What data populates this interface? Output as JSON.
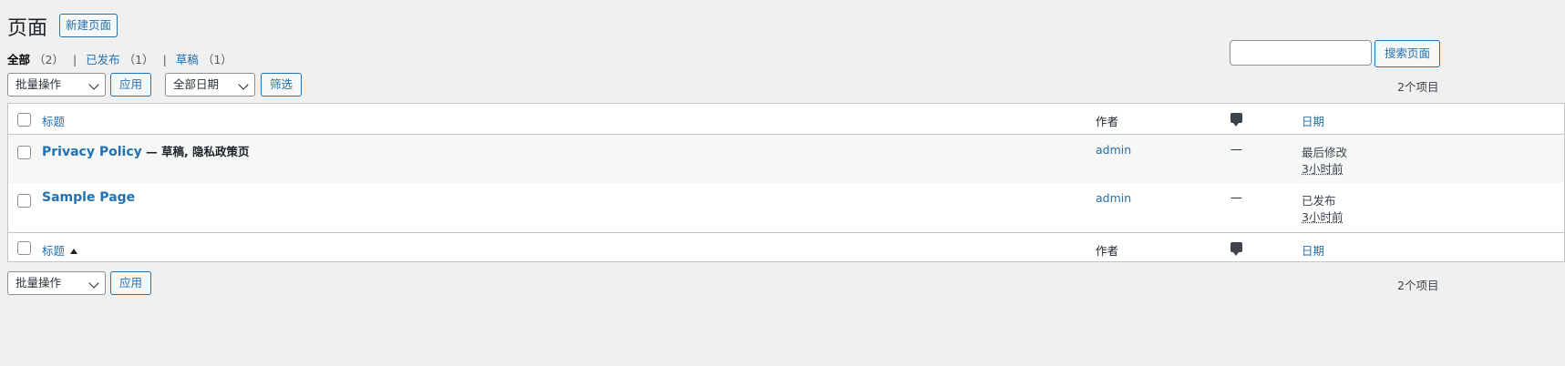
{
  "header": {
    "title": "页面",
    "add_new_label": "新建页面"
  },
  "views": [
    {
      "label": "全部",
      "count": "（2）",
      "current": true
    },
    {
      "label": "已发布",
      "count": "（1）",
      "current": false
    },
    {
      "label": "草稿",
      "count": "（1）",
      "current": false
    }
  ],
  "search": {
    "value": "",
    "button_label": "搜索页面"
  },
  "toolbar_top": {
    "bulk_action": "批量操作",
    "apply_label": "应用",
    "date_filter": "全部日期",
    "filter_label": "筛选",
    "items_count": "2个项目"
  },
  "table": {
    "columns": {
      "title": "标题",
      "author": "作者",
      "date": "日期"
    },
    "rows": [
      {
        "title": "Privacy Policy",
        "state": " — 草稿, 隐私政策页",
        "author": "admin",
        "comments": "—",
        "date_label": "最后修改",
        "date_value": "3小时前"
      },
      {
        "title": "Sample Page",
        "state": "",
        "author": "admin",
        "comments": "—",
        "date_label": "已发布",
        "date_value": "3小时前"
      }
    ]
  },
  "toolbar_bottom": {
    "bulk_action": "批量操作",
    "apply_label": "应用",
    "items_count": "2个项目"
  },
  "colors": {
    "link": "#2271b1",
    "background": "#f0f0f1",
    "border": "#c3c4c7"
  }
}
